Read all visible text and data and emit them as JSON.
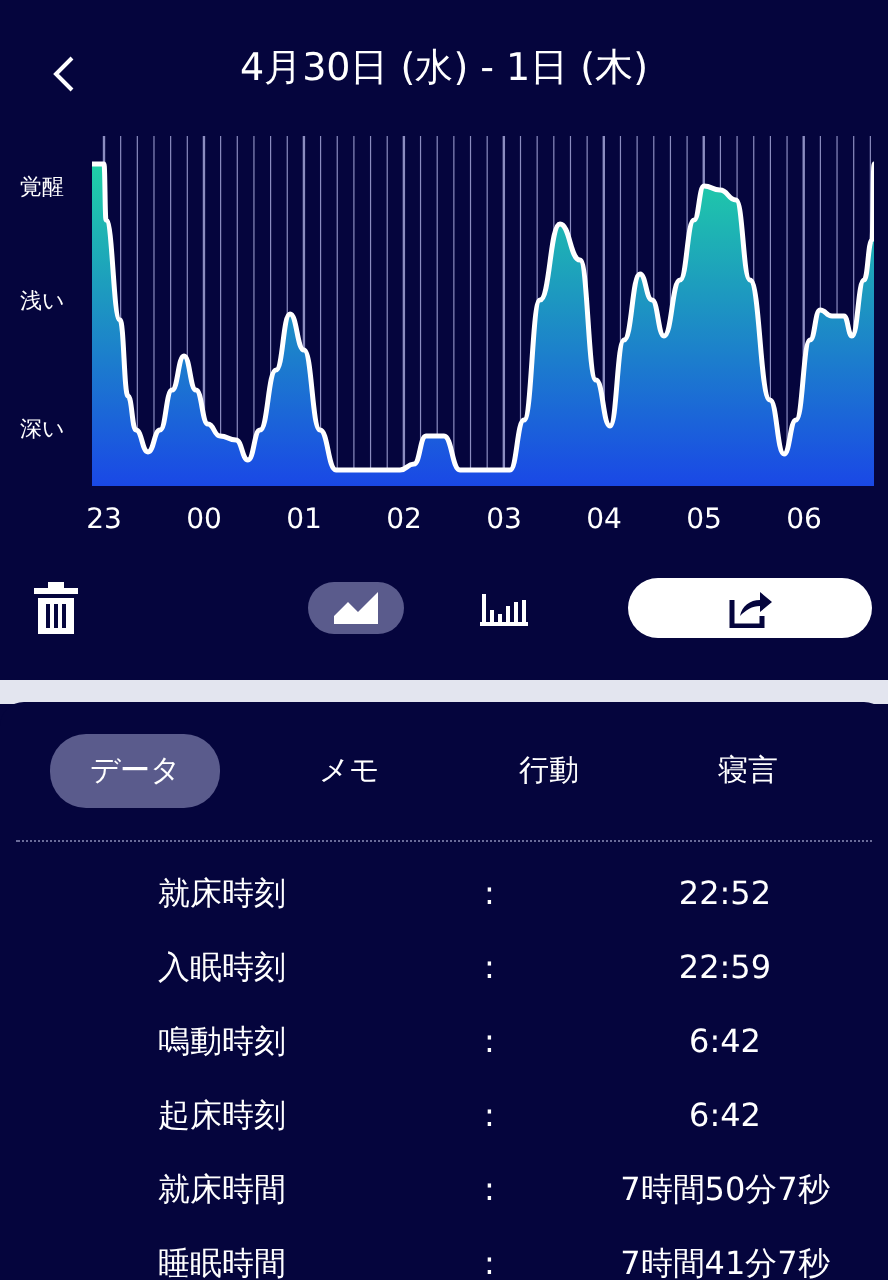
{
  "header": {
    "title": "4月30日 (水) - 1日 (木)"
  },
  "chart": {
    "y_labels": [
      "覚醒",
      "浅い",
      "深い"
    ],
    "x_labels": [
      "23",
      "00",
      "01",
      "02",
      "03",
      "04",
      "05",
      "06"
    ]
  },
  "views": [
    {
      "kind": "line",
      "selected": true
    },
    {
      "kind": "bar",
      "selected": false
    }
  ],
  "tabs": [
    {
      "label": "データ",
      "selected": true
    },
    {
      "label": "メモ",
      "selected": false
    },
    {
      "label": "行動",
      "selected": false
    },
    {
      "label": "寝言",
      "selected": false
    }
  ],
  "rows": [
    {
      "label": "就床時刻",
      "separator": ":",
      "value": "22:52"
    },
    {
      "label": "入眠時刻",
      "separator": ":",
      "value": "22:59"
    },
    {
      "label": "鳴動時刻",
      "separator": ":",
      "value": "6:42"
    },
    {
      "label": "起床時刻",
      "separator": ":",
      "value": "6:42"
    },
    {
      "label": "就床時間",
      "separator": ":",
      "value": "7時間50分7秒"
    },
    {
      "label": "睡眠時間",
      "separator": ":",
      "value": "7時間41分7秒"
    }
  ]
}
